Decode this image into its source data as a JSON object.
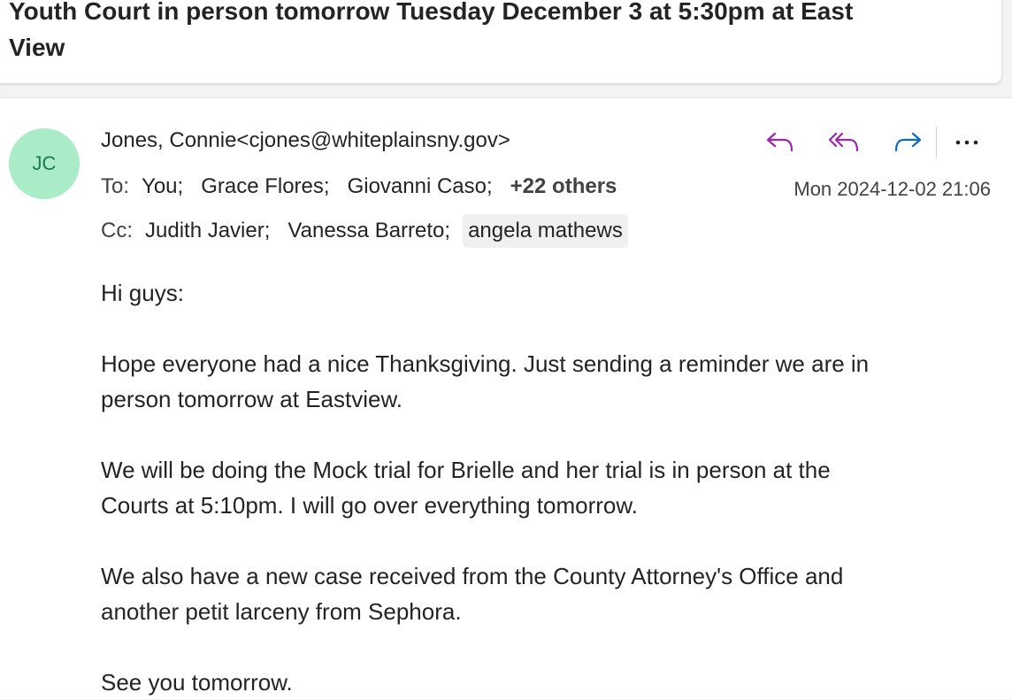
{
  "subject": {
    "line1": "Youth Court in person tomorrow Tuesday December 3 at 5:30pm at East",
    "line2": "View"
  },
  "sender": {
    "initials": "JC",
    "display": "Jones, Connie<cjones@whiteplainsny.gov>",
    "avatar_color": "#a9ecc7"
  },
  "actions": {
    "reply_icon": "reply-icon",
    "reply_all_icon": "reply-all-icon",
    "forward_icon": "forward-icon",
    "more_icon": "more-icon",
    "accent_color": "#9c27b0",
    "forward_color": "#0f6cbd"
  },
  "to": {
    "label": "To:",
    "recipients": [
      "You;",
      "Grace Flores;",
      "Giovanni Caso;"
    ],
    "others": "+22 others"
  },
  "cc": {
    "label": "Cc:",
    "recipients": [
      "Judith Javier;",
      "Vanessa Barreto;",
      "angela mathews"
    ]
  },
  "date": "Mon 2024-12-02 21:06",
  "body": {
    "greeting": "Hi guys:",
    "p1_line1": "Hope everyone had a nice Thanksgiving. Just sending a reminder we are in",
    "p1_line2": "person tomorrow at Eastview.",
    "p2_line1": "We will be doing the Mock trial for Brielle and her trial is in person at the",
    "p2_line2": "Courts at 5:10pm. I will go over everything tomorrow.",
    "p3_line1": "We also have a new case received from the County Attorney's Office and",
    "p3_line2": "another petit larceny from Sephora.",
    "closing": "See you tomorrow."
  }
}
